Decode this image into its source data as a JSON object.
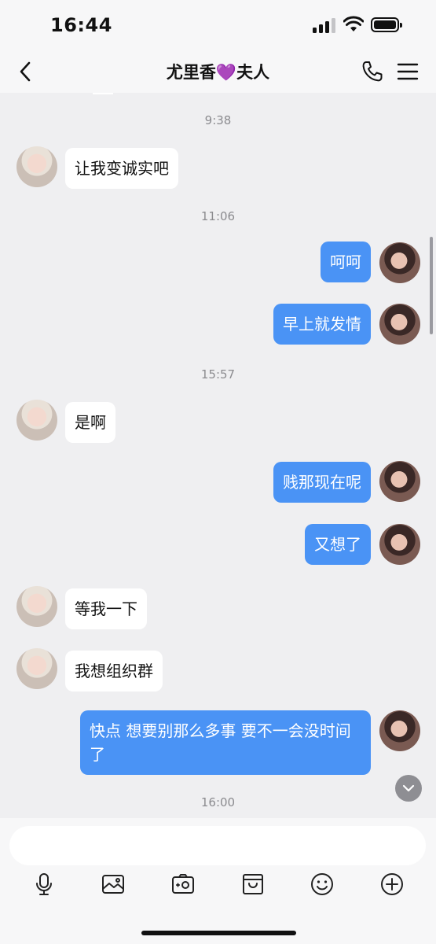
{
  "status_bar": {
    "time": "16:44"
  },
  "header": {
    "title": "尤里香💜夫人"
  },
  "chat": {
    "timestamps": [
      "9:38",
      "11:06",
      "15:57",
      "16:00"
    ],
    "messages": [
      {
        "side": "left",
        "text": "让我变诚实吧"
      },
      {
        "side": "right",
        "text": "呵呵"
      },
      {
        "side": "right",
        "text": "早上就发情"
      },
      {
        "side": "left",
        "text": "是啊"
      },
      {
        "side": "right",
        "text": "贱那现在呢"
      },
      {
        "side": "right",
        "text": "又想了"
      },
      {
        "side": "left",
        "text": "等我一下"
      },
      {
        "side": "left",
        "text": "我想组织群"
      },
      {
        "side": "right",
        "text": "快点 想要别那么多事 要不一会没时间了"
      }
    ]
  },
  "input": {
    "placeholder": ""
  },
  "icons": {
    "back": "chevron-left-icon",
    "call": "phone-icon",
    "menu": "hamburger-menu-icon",
    "scroll_down": "chevron-down-icon",
    "toolbar": [
      "microphone-icon",
      "image-icon",
      "camera-icon",
      "bag-icon",
      "smiley-icon",
      "plus-circle-icon"
    ]
  },
  "colors": {
    "outgoing_bubble": "#4a93f5",
    "incoming_bubble": "#ffffff",
    "background": "#efeff1"
  }
}
